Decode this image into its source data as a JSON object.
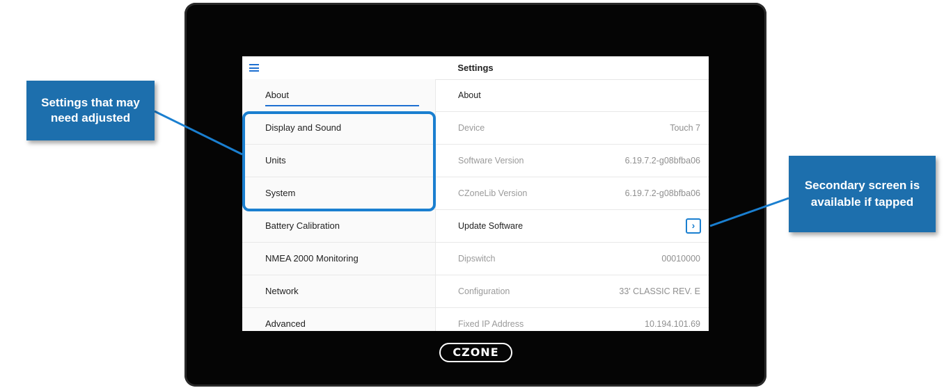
{
  "screen": {
    "title": "Settings",
    "menu_items": [
      {
        "label": "About",
        "active": true
      },
      {
        "label": "Display and Sound"
      },
      {
        "label": "Units"
      },
      {
        "label": "System"
      },
      {
        "label": "Battery Calibration"
      },
      {
        "label": "NMEA 2000 Monitoring"
      },
      {
        "label": "Network"
      },
      {
        "label": "Advanced"
      }
    ],
    "detail_rows": [
      {
        "label": "About",
        "value": ""
      },
      {
        "label": "Device",
        "value": "Touch 7"
      },
      {
        "label": "Software Version",
        "value": "6.19.7.2-g08bfba06"
      },
      {
        "label": "CZoneLib Version",
        "value": "6.19.7.2-g08bfba06"
      },
      {
        "label": "Update Software",
        "value": ""
      },
      {
        "label": "Dipswitch",
        "value": "00010000"
      },
      {
        "label": "Configuration",
        "value": "33' CLASSIC REV. E"
      },
      {
        "label": "Fixed IP Address",
        "value": "10.194.101.69"
      }
    ],
    "chevron": "›"
  },
  "brand": {
    "logo": "CZONE"
  },
  "callouts": {
    "left": "Settings that may need adjusted",
    "right": "Secondary screen is available if tapped"
  },
  "colors": {
    "accent": "#1a7fd0",
    "callout_bg": "#1d6fad",
    "bezel": "#050505"
  },
  "icons": {
    "hamburger": "hamburger-menu-icon",
    "chevron": "chevron-right-icon"
  }
}
